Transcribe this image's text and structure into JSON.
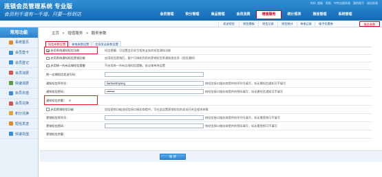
{
  "header": {
    "title": "连锁会员管理系统 专业版",
    "slogan": "会员利千道有一千道、只要一秒到达",
    "toplinks": [
      "你好, 超级",
      "帮助",
      "中性加盟系统",
      "我的账号",
      "退出系统"
    ]
  },
  "mainnav": [
    {
      "label": "会员管理",
      "active": false
    },
    {
      "label": "积分管理",
      "active": false
    },
    {
      "label": "商品管理",
      "active": false
    },
    {
      "label": "会员消费",
      "active": false
    },
    {
      "label": "增值服务",
      "active": true
    },
    {
      "label": "统计报表",
      "active": false
    },
    {
      "label": "微信管理",
      "active": false
    },
    {
      "label": "系统管理",
      "active": false
    }
  ],
  "subnav": [
    {
      "label": "发送短信",
      "active": false
    },
    {
      "label": "短信模板",
      "active": false
    },
    {
      "label": "短信记录",
      "active": false
    },
    {
      "label": "短信统计",
      "active": false
    },
    {
      "label": "来电记录",
      "active": false
    },
    {
      "label": "电子优惠券",
      "active": false
    },
    {
      "label": "服务参数",
      "active": true
    }
  ],
  "sidebar": {
    "title": "常用功能",
    "items": [
      {
        "label": "系统首页",
        "icon": "home-icon",
        "color": "#e28a2b"
      },
      {
        "label": "会员登卡",
        "icon": "user-add-icon",
        "color": "#3b8fd8"
      },
      {
        "label": "会员登记",
        "icon": "users-icon",
        "color": "#3b8fd8"
      },
      {
        "label": "会员消费",
        "icon": "cart-icon",
        "color": "#d9534f"
      },
      {
        "label": "快速消费",
        "icon": "lightning-icon",
        "color": "#5a9e3a"
      },
      {
        "label": "会员充值",
        "icon": "card-icon",
        "color": "#3b8fd8"
      },
      {
        "label": "会员兑换",
        "icon": "gift-icon",
        "color": "#d9534f"
      },
      {
        "label": "积分兑换",
        "icon": "coin-icon",
        "color": "#e2a52b"
      },
      {
        "label": "短信发送",
        "icon": "sms-icon",
        "color": "#e28a2b"
      },
      {
        "label": "快速充值",
        "icon": "bolt-icon",
        "color": "#3b8fd8"
      }
    ]
  },
  "breadcrumb": {
    "items": [
      "主页",
      "增值服务",
      "服务参数"
    ],
    "sep": ">"
  },
  "tabs": [
    {
      "label": "短信参数设置",
      "active": true
    },
    {
      "label": "来电参数设置",
      "active": false
    },
    {
      "label": "信息发送参数设置",
      "active": false
    }
  ],
  "form": {
    "rows": [
      {
        "type": "check",
        "label": "启用系统通知短信功能",
        "checked": true,
        "desc": "短信提醒，可设置会员发生相关业务的短信通知功能"
      },
      {
        "type": "check",
        "label": "启用系统通知短信营销功能",
        "checked": false,
        "desc": "启用短信营销后，客户可接收到您的营销短信等通知类信息（短信通知）"
      },
      {
        "type": "check",
        "label": "启用统一所有店铺短信提醒",
        "checked": false,
        "desc": "不启用统一所有店铺短信提醒，各店铺单独设置"
      },
      {
        "type": "input",
        "label": "统一店铺短信发送号码：",
        "value": "",
        "desc": ""
      },
      {
        "type": "input",
        "label": "通知短信序列号：",
        "value": "liantuoshiyong",
        "desc2": "按短信接口服务商提供的序列号填写，如无需短信通知可不填写"
      },
      {
        "type": "input",
        "label": "通知短信密码：",
        "value": "••••••••",
        "desc2": "按短信接口服务商提供的密码填写，如无需短信通知可不填写"
      },
      {
        "type": "section",
        "label": "通知短信余额：",
        "value": "0"
      },
      {
        "type": "check",
        "label": "启用营销短信功能",
        "checked": false,
        "desc": "短信营销功能由短信接口服务商提供，可在此设置营销短信的发送开关及相关参数"
      },
      {
        "type": "input",
        "label": "营销短信序列号：",
        "value": "",
        "desc2": "按短信接口服务商提供的序列号填写，如无需营销可不填写"
      },
      {
        "type": "input",
        "label": "营销短信密码：",
        "value": "",
        "desc2": "按短信接口服务商提供的密码填写，如无需营销可不填写"
      },
      {
        "type": "section",
        "label": "营销短信余额：",
        "value": ""
      }
    ]
  },
  "save_label": "保 存",
  "colors": {
    "accent": "#1569b5",
    "highlight": "#d0021b"
  }
}
